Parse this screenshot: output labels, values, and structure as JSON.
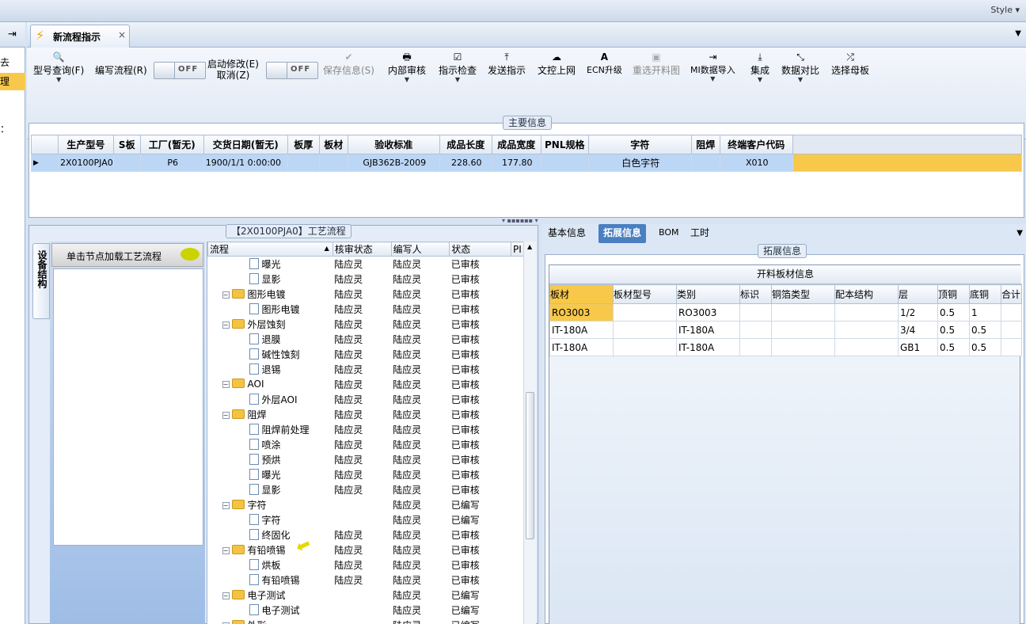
{
  "topbar": {
    "style_label": "Style ▾"
  },
  "leftstrip": {
    "items": [
      "去",
      "理",
      "："
    ]
  },
  "tabs": [
    {
      "label": "新流程指示",
      "close": "×"
    }
  ],
  "toolbar": {
    "buttons": [
      {
        "id": "model-query",
        "label": "型号查询(F)",
        "icon": "🔍",
        "caret": true,
        "disabled": false
      },
      {
        "id": "write-flow",
        "label": "编写流程(R)",
        "icon": "",
        "caret": false,
        "disabled": false
      },
      {
        "id": "start-modify",
        "label": "启动修改(E)",
        "label2": "取消(Z)",
        "icon": "",
        "caret": false,
        "disabled": false
      },
      {
        "id": "save-info",
        "label": "保存信息(S)",
        "icon": "✔",
        "caret": false,
        "disabled": true
      },
      {
        "id": "internal-review",
        "label": "内部审核",
        "icon": "🖶",
        "caret": true,
        "disabled": false
      },
      {
        "id": "instruct-check",
        "label": "指示检查",
        "icon": "☑",
        "caret": true,
        "disabled": false
      },
      {
        "id": "send-instruct",
        "label": "发送指示",
        "icon": "⤒",
        "caret": false,
        "disabled": false
      },
      {
        "id": "upload-file",
        "label": "文控上网",
        "icon": "☁",
        "caret": false,
        "disabled": false
      },
      {
        "id": "ecn-upgrade",
        "label": "ECN升级",
        "icon": "A",
        "caret": false,
        "disabled": false
      },
      {
        "id": "reselect-cut",
        "label": "重选开料图",
        "icon": "▣",
        "caret": false,
        "disabled": true
      },
      {
        "id": "mi-import",
        "label": "MI数据导入",
        "icon": "⇥",
        "caret": true,
        "disabled": false
      },
      {
        "id": "integrate",
        "label": "集成",
        "icon": "⤓",
        "caret": true,
        "disabled": false
      },
      {
        "id": "data-compare",
        "label": "数据对比",
        "icon": "⤡",
        "caret": true,
        "disabled": false
      },
      {
        "id": "select-mother",
        "label": "选择母板",
        "icon": "⤮",
        "caret": false,
        "disabled": false
      }
    ],
    "toggle_off": "OFF"
  },
  "main_info": {
    "title": "主要信息",
    "columns": [
      "生产型号",
      "S板",
      "工厂(暂无)",
      "交货日期(暂无)",
      "板厚",
      "板材",
      "验收标准",
      "成品长度",
      "成品宽度",
      "PNL规格",
      "字符",
      "阻焊",
      "终端客户代码"
    ],
    "rows": [
      [
        "2X0100PJA0",
        "",
        "P6",
        "1900/1/1 0:00:00",
        "",
        "",
        "GJB362B-2009",
        "228.60",
        "177.80",
        "",
        "白色字符",
        "",
        "X010"
      ]
    ]
  },
  "flow": {
    "title": "【2X0100PJA0】工艺流程",
    "side_tab": "设备结构",
    "load_label": "单击节点加载工艺流程",
    "columns": [
      "流程",
      "核审状态",
      "编写人",
      "状态",
      "PI"
    ],
    "rows": [
      {
        "level": 2,
        "type": "doc",
        "name": "曝光",
        "a": "陆应灵",
        "b": "陆应灵",
        "c": "已审核"
      },
      {
        "level": 2,
        "type": "doc",
        "name": "显影",
        "a": "陆应灵",
        "b": "陆应灵",
        "c": "已审核"
      },
      {
        "level": 1,
        "type": "folder",
        "name": "图形电镀",
        "a": "陆应灵",
        "b": "陆应灵",
        "c": "已审核"
      },
      {
        "level": 2,
        "type": "doc",
        "name": "图形电镀",
        "a": "陆应灵",
        "b": "陆应灵",
        "c": "已审核"
      },
      {
        "level": 1,
        "type": "folder",
        "name": "外层蚀刻",
        "a": "陆应灵",
        "b": "陆应灵",
        "c": "已审核"
      },
      {
        "level": 2,
        "type": "doc",
        "name": "退膜",
        "a": "陆应灵",
        "b": "陆应灵",
        "c": "已审核"
      },
      {
        "level": 2,
        "type": "doc",
        "name": "碱性蚀刻",
        "a": "陆应灵",
        "b": "陆应灵",
        "c": "已审核"
      },
      {
        "level": 2,
        "type": "doc",
        "name": "退锡",
        "a": "陆应灵",
        "b": "陆应灵",
        "c": "已审核"
      },
      {
        "level": 1,
        "type": "folder",
        "name": "AOI",
        "a": "陆应灵",
        "b": "陆应灵",
        "c": "已审核"
      },
      {
        "level": 2,
        "type": "doc",
        "name": "外层AOI",
        "a": "陆应灵",
        "b": "陆应灵",
        "c": "已审核"
      },
      {
        "level": 1,
        "type": "folder",
        "name": "阻焊",
        "a": "陆应灵",
        "b": "陆应灵",
        "c": "已审核"
      },
      {
        "level": 2,
        "type": "doc",
        "name": "阻焊前处理",
        "a": "陆应灵",
        "b": "陆应灵",
        "c": "已审核"
      },
      {
        "level": 2,
        "type": "doc",
        "name": "喷涂",
        "a": "陆应灵",
        "b": "陆应灵",
        "c": "已审核"
      },
      {
        "level": 2,
        "type": "doc",
        "name": "预烘",
        "a": "陆应灵",
        "b": "陆应灵",
        "c": "已审核"
      },
      {
        "level": 2,
        "type": "doc",
        "name": "曝光",
        "a": "陆应灵",
        "b": "陆应灵",
        "c": "已审核"
      },
      {
        "level": 2,
        "type": "doc",
        "name": "显影",
        "a": "陆应灵",
        "b": "陆应灵",
        "c": "已审核"
      },
      {
        "level": 1,
        "type": "folder",
        "name": "字符",
        "a": "",
        "b": "陆应灵",
        "c": "已编写"
      },
      {
        "level": 2,
        "type": "doc",
        "name": "字符",
        "a": "",
        "b": "陆应灵",
        "c": "已编写"
      },
      {
        "level": 2,
        "type": "doc",
        "name": "终固化",
        "a": "陆应灵",
        "b": "陆应灵",
        "c": "已审核"
      },
      {
        "level": 1,
        "type": "folder",
        "name": "有铅喷锡",
        "a": "陆应灵",
        "b": "陆应灵",
        "c": "已审核"
      },
      {
        "level": 2,
        "type": "doc",
        "name": "烘板",
        "a": "陆应灵",
        "b": "陆应灵",
        "c": "已审核"
      },
      {
        "level": 2,
        "type": "doc",
        "name": "有铅喷锡",
        "a": "陆应灵",
        "b": "陆应灵",
        "c": "已审核"
      },
      {
        "level": 1,
        "type": "folder",
        "name": "电子测试",
        "a": "",
        "b": "陆应灵",
        "c": "已编写"
      },
      {
        "level": 2,
        "type": "doc",
        "name": "电子测试",
        "a": "",
        "b": "陆应灵",
        "c": "已编写"
      },
      {
        "level": 1,
        "type": "folder",
        "name": "外形",
        "a": "",
        "b": "陆应灵",
        "c": "已编写"
      }
    ]
  },
  "right": {
    "tabs": [
      "基本信息",
      "拓展信息",
      "BOM",
      "工时"
    ],
    "active_tab": 1,
    "group_title": "拓展信息",
    "table_title": "开料板材信息",
    "columns": [
      "板材",
      "板材型号",
      "类别",
      "标识",
      "铜箔类型",
      "配本结构",
      "层",
      "顶铜",
      "底铜",
      "合计"
    ],
    "rows": [
      [
        "RO3003",
        "",
        "RO3003",
        "",
        "",
        "",
        "1/2",
        "0.5",
        "1",
        ""
      ],
      [
        "IT-180A",
        "",
        "IT-180A",
        "",
        "",
        "",
        "3/4",
        "0.5",
        "0.5",
        ""
      ],
      [
        "IT-180A",
        "",
        "IT-180A",
        "",
        "",
        "",
        "GB1",
        "0.5",
        "0.5",
        ""
      ]
    ]
  },
  "colors": {
    "accent": "#4a7fc1",
    "selected_row": "#bcd6f5",
    "highlight": "#f7c84a"
  }
}
